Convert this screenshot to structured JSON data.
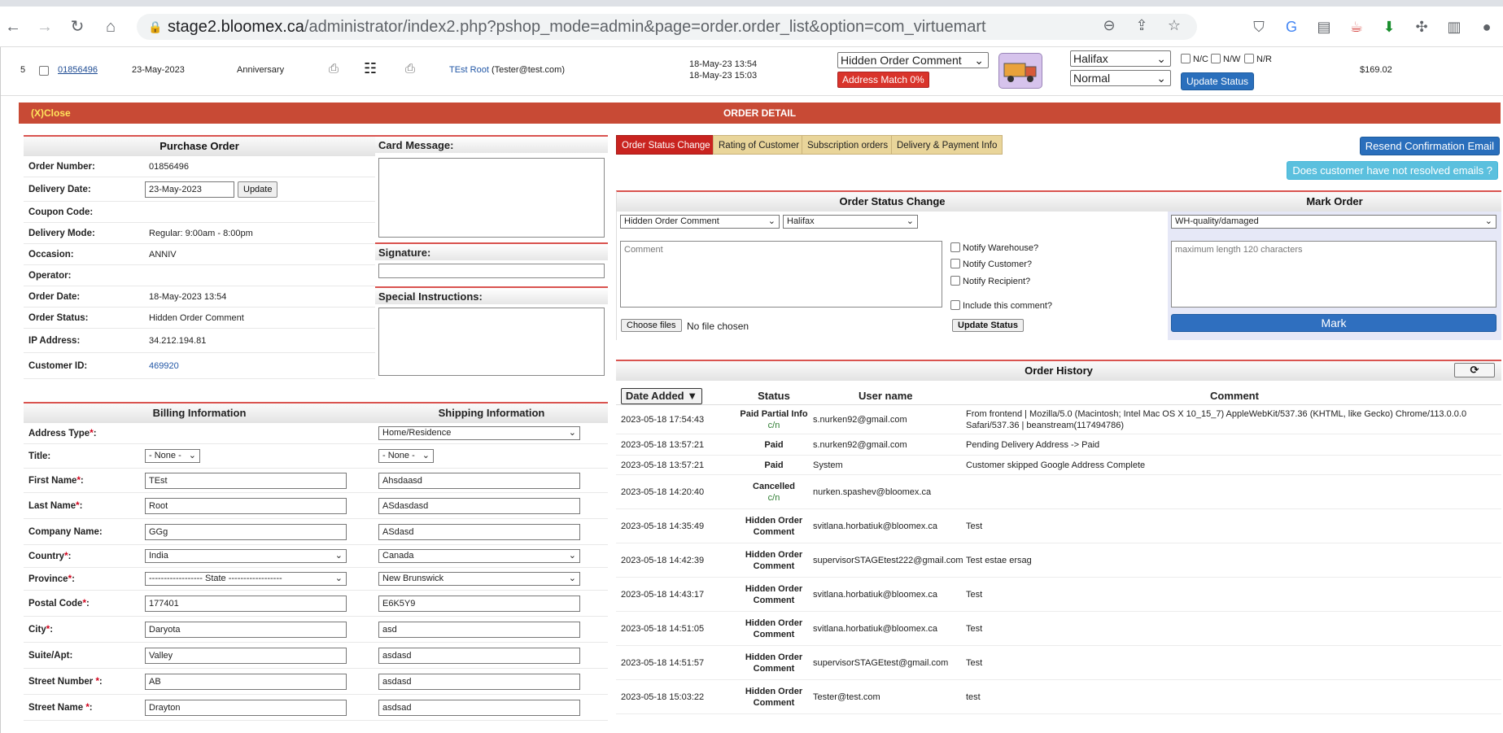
{
  "browser": {
    "url_host": "stage2.bloomex.ca",
    "url_path": "/administrator/index2.php?pshop_mode=admin&page=order.order_list&option=com_virtuemart"
  },
  "order_row": {
    "index": "5",
    "order_number": "01856496",
    "date": "23-May-2023",
    "occasion": "Anniversary",
    "customer_name": "TEst Root",
    "customer_email": "(Tester@test.com)",
    "time1": "18-May-23 13:54",
    "time2": "18-May-23 15:03",
    "status_select": "Hidden Order Comment",
    "address_match": "Address Match 0%",
    "warehouse_select": "Halifax",
    "priority_select": "Normal",
    "check_nc": "N/C",
    "check_nw": "N/W",
    "check_nr": "N/R",
    "update_status": "Update Status",
    "total": "$169.02"
  },
  "detail_bar": {
    "close": "(X)Close",
    "title": "ORDER DETAIL"
  },
  "purchase_order": {
    "title": "Purchase Order",
    "order_number_label": "Order Number:",
    "order_number": "01856496",
    "delivery_date_label": "Delivery Date:",
    "delivery_date": "23-May-2023",
    "update_btn": "Update",
    "coupon_label": "Coupon Code:",
    "delivery_mode_label": "Delivery Mode:",
    "delivery_mode": "Regular: 9:00am - 8:00pm",
    "occasion_label": "Occasion:",
    "occasion": "ANNIV",
    "operator_label": "Operator:",
    "order_date_label": "Order Date:",
    "order_date": "18-May-2023 13:54",
    "order_status_label": "Order Status:",
    "order_status": "Hidden Order Comment",
    "ip_label": "IP Address:",
    "ip": "34.212.194.81",
    "customer_id_label": "Customer ID:",
    "customer_id": "469920"
  },
  "card": {
    "card_message": "Card Message:",
    "signature": "Signature:",
    "special": "Special Instructions:"
  },
  "billing": {
    "billing_title": "Billing Information",
    "shipping_title": "Shipping Information",
    "address_type_label": "Address Type",
    "ship_address_type": "Home/Residence",
    "title_label": "Title:",
    "bill_title": "- None -",
    "ship_title": "- None -",
    "first_name_label": "First Name",
    "bill_first": "TEst",
    "ship_first": "Ahsdaasd",
    "last_name_label": "Last Name",
    "bill_last": "Root",
    "ship_last": "ASdasdasd",
    "company_label": "Company Name:",
    "bill_company": "GGg",
    "ship_company": "ASdasd",
    "country_label": "Country",
    "bill_country": "India",
    "ship_country": "Canada",
    "province_label": "Province",
    "bill_province": "------------------ State ------------------",
    "ship_province": "New Brunswick",
    "postal_label": "Postal Code",
    "bill_postal": "177401",
    "ship_postal": "E6K5Y9",
    "city_label": "City",
    "bill_city": "Daryota",
    "ship_city": "asd",
    "suite_label": "Suite/Apt:",
    "bill_suite": "Valley",
    "ship_suite": "asdasd",
    "street_num_label": "Street Number ",
    "bill_street_num": "AB",
    "ship_street_num": "asdasd",
    "street_name_label": "Street Name ",
    "bill_street_name": "Drayton",
    "ship_street_name": "asdsad"
  },
  "tabs": [
    "Order Status Change",
    "Rating of Customer",
    "Subscription orders",
    "Delivery & Payment Info"
  ],
  "resend_btn": "Resend Confirmation Email",
  "unresolved_btn": "Does customer have not resolved emails ?",
  "status_change": {
    "title": "Order Status Change",
    "status_select": "Hidden Order Comment",
    "warehouse_select": "Halifax",
    "comment_placeholder": "Comment",
    "notify_warehouse": "Notify Warehouse?",
    "notify_customer": "Notify Customer?",
    "notify_recipient": "Notify Recipient?",
    "include_comment": "Include this comment?",
    "choose_files": "Choose files",
    "no_file": "No file chosen",
    "update_btn": "Update Status"
  },
  "mark_order": {
    "title": "Mark Order",
    "select": "WH-quality/damaged",
    "placeholder": "maximum length 120 characters",
    "mark_btn": "Mark"
  },
  "history": {
    "title": "Order History",
    "col_date": "Date Added ▼",
    "col_status": "Status",
    "col_user": "User name",
    "col_comment": "Comment",
    "rows": [
      {
        "date": "2023-05-18 17:54:43",
        "status": "Paid Partial Info",
        "sub": "c/n",
        "user": "s.nurken92@gmail.com",
        "comment": "From frontend | Mozilla/5.0 (Macintosh; Intel Mac OS X 10_15_7) AppleWebKit/537.36 (KHTML, like Gecko) Chrome/113.0.0.0 Safari/537.36 | beanstream(117494786)"
      },
      {
        "date": "2023-05-18 13:57:21",
        "status": "Paid",
        "sub": "",
        "user": "s.nurken92@gmail.com",
        "comment": "Pending Delivery Address -> Paid"
      },
      {
        "date": "2023-05-18 13:57:21",
        "status": "Paid",
        "sub": "",
        "user": "System",
        "comment": "Customer skipped Google Address Complete"
      },
      {
        "date": "2023-05-18 14:20:40",
        "status": "Cancelled",
        "sub": "c/n",
        "user": "nurken.spashev@bloomex.ca",
        "comment": ""
      },
      {
        "date": "2023-05-18 14:35:49",
        "status": "Hidden Order Comment",
        "sub": "",
        "user": "svitlana.horbatiuk@bloomex.ca",
        "comment": "Test"
      },
      {
        "date": "2023-05-18 14:42:39",
        "status": "Hidden Order Comment",
        "sub": "",
        "user": "supervisorSTAGEtest222@gmail.com",
        "comment": "Test estae ersag"
      },
      {
        "date": "2023-05-18 14:43:17",
        "status": "Hidden Order Comment",
        "sub": "",
        "user": "svitlana.horbatiuk@bloomex.ca",
        "comment": "Test"
      },
      {
        "date": "2023-05-18 14:51:05",
        "status": "Hidden Order Comment",
        "sub": "",
        "user": "svitlana.horbatiuk@bloomex.ca",
        "comment": "Test"
      },
      {
        "date": "2023-05-18 14:51:57",
        "status": "Hidden Order Comment",
        "sub": "",
        "user": "supervisorSTAGEtest@gmail.com",
        "comment": "Test"
      },
      {
        "date": "2023-05-18 15:03:22",
        "status": "Hidden Order Comment",
        "sub": "",
        "user": "Tester@test.com",
        "comment": "test"
      }
    ]
  }
}
